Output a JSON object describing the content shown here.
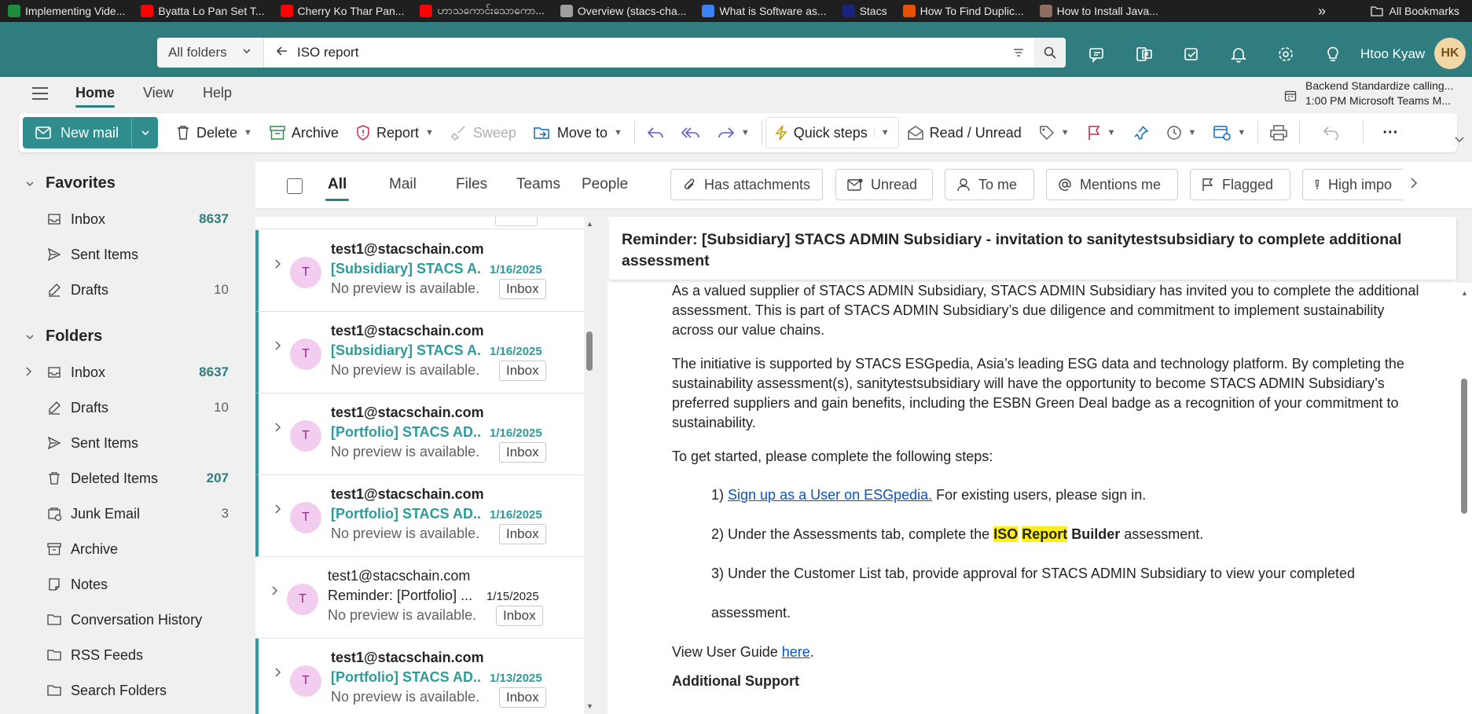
{
  "bookmarks": {
    "items": [
      {
        "label": "Implementing Vide...",
        "color": "#1e8e3e"
      },
      {
        "label": "Byatta Lo Pan Set T...",
        "color": "#ff0000"
      },
      {
        "label": "Cherry Ko Thar Pan...",
        "color": "#ff0000"
      },
      {
        "label": "ဟာသကောင်းသောကော...",
        "color": "#ff0000"
      },
      {
        "label": "Overview (stacs-cha...",
        "color": "#9e9e9e"
      },
      {
        "label": "What is Software as...",
        "color": "#3b82f6"
      },
      {
        "label": "Stacs",
        "color": "#1a237e"
      },
      {
        "label": "How To Find Duplic...",
        "color": "#e65100"
      },
      {
        "label": "How to Install Java...",
        "color": "#8d6e63"
      }
    ],
    "more": "»",
    "all_label": "All Bookmarks"
  },
  "header": {
    "folder_select": "All folders",
    "search_value": "ISO report",
    "user_name": "Htoo Kyaw",
    "user_initials": "HK",
    "accent": "#2f7d7e"
  },
  "ribbon_tabs": {
    "tabs": [
      "Home",
      "View",
      "Help"
    ],
    "reminder_title": "Backend Standardize calling...",
    "reminder_detail": "1:00 PM Microsoft Teams M..."
  },
  "ribbon": {
    "new_mail": "New mail",
    "delete": "Delete",
    "archive": "Archive",
    "report": "Report",
    "sweep": "Sweep",
    "move_to": "Move to",
    "quick_steps": "Quick steps",
    "read_unread": "Read / Unread",
    "more": "···"
  },
  "nav": {
    "favorites_label": "Favorites",
    "favorites": [
      {
        "label": "Inbox",
        "count": "8637",
        "unread": true,
        "icon": "inbox-icon"
      },
      {
        "label": "Sent Items",
        "count": "",
        "unread": false,
        "icon": "sent-icon"
      },
      {
        "label": "Drafts",
        "count": "10",
        "unread": false,
        "icon": "drafts-icon"
      }
    ],
    "folders_label": "Folders",
    "folders": [
      {
        "label": "Inbox",
        "count": "8637",
        "unread": true,
        "icon": "inbox-icon"
      },
      {
        "label": "Drafts",
        "count": "10",
        "unread": false,
        "icon": "drafts-icon"
      },
      {
        "label": "Sent Items",
        "count": "",
        "unread": false,
        "icon": "sent-icon"
      },
      {
        "label": "Deleted Items",
        "count": "207",
        "unread": true,
        "icon": "trash-icon"
      },
      {
        "label": "Junk Email",
        "count": "3",
        "unread": false,
        "icon": "junk-icon"
      },
      {
        "label": "Archive",
        "count": "",
        "unread": false,
        "icon": "archive-icon"
      },
      {
        "label": "Notes",
        "count": "",
        "unread": false,
        "icon": "notes-icon"
      },
      {
        "label": "Conversation History",
        "count": "",
        "unread": false,
        "icon": "folder-icon"
      },
      {
        "label": "RSS Feeds",
        "count": "",
        "unread": false,
        "icon": "folder-icon"
      },
      {
        "label": "Search Folders",
        "count": "",
        "unread": false,
        "icon": "folder-icon"
      }
    ]
  },
  "filters": {
    "tabs": [
      "All",
      "Mail",
      "Files",
      "Teams",
      "People"
    ],
    "chips": [
      "Has attachments",
      "Unread",
      "To me",
      "Mentions me",
      "Flagged",
      "High impo"
    ]
  },
  "messages": [
    {
      "from": "test1@stacschain.com",
      "subject": "[Subsidiary] STACS A...",
      "date": "1/16/2025",
      "preview": "No preview is available.",
      "tag": "Inbox",
      "unread": true,
      "initial": "T"
    },
    {
      "from": "test1@stacschain.com",
      "subject": "[Subsidiary] STACS A...",
      "date": "1/16/2025",
      "preview": "No preview is available.",
      "tag": "Inbox",
      "unread": true,
      "initial": "T"
    },
    {
      "from": "test1@stacschain.com",
      "subject": "[Portfolio] STACS AD...",
      "date": "1/16/2025",
      "preview": "No preview is available.",
      "tag": "Inbox",
      "unread": true,
      "initial": "T"
    },
    {
      "from": "test1@stacschain.com",
      "subject": "[Portfolio] STACS AD...",
      "date": "1/16/2025",
      "preview": "No preview is available.",
      "tag": "Inbox",
      "unread": true,
      "initial": "T"
    },
    {
      "from": "test1@stacschain.com",
      "subject": "Reminder: [Portfolio] ...",
      "date": "1/15/2025",
      "preview": "No preview is available.",
      "tag": "Inbox",
      "unread": false,
      "initial": "T"
    },
    {
      "from": "test1@stacschain.com",
      "subject": "[Portfolio] STACS AD...",
      "date": "1/13/2025",
      "preview": "No preview is available.",
      "tag": "Inbox",
      "unread": true,
      "initial": "T"
    }
  ],
  "reading": {
    "subject": "Reminder: [Subsidiary] STACS ADMIN Subsidiary - invitation to sanitytestsubsidiary to complete additional assessment",
    "para1": "As a valued supplier of STACS ADMIN Subsidiary, STACS ADMIN Subsidiary has invited you to complete the additional assessment. This is part of STACS ADMIN Subsidiary’s due diligence and commitment to implement sustainability across our value chains.",
    "para2": "The initiative is supported by STACS ESGpedia, Asia’s leading ESG data and technology platform. By completing the sustainability assessment(s), sanitytestsubsidiary will have the opportunity to become STACS ADMIN Subsidiary’s preferred suppliers and gain benefits, including the ESBN Green Deal badge as a recognition of your commitment to sustainability.",
    "para3": "To get started, please complete the following steps:",
    "step1_prefix": "1) ",
    "step1_link": "Sign up as a User on ESGpedia.",
    "step1_suffix": " For existing users, please sign in.",
    "step2_prefix": "2) Under the Assessments tab, complete the ",
    "step2_hl1": "ISO",
    "step2_hl2": "Report",
    "step2_bold": "Builder",
    "step2_suffix": " assessment.",
    "step3": "3) Under the Customer List tab, provide approval for STACS ADMIN Subsidiary to view your completed",
    "step3_cont": "assessment.",
    "guide_prefix": "View User Guide ",
    "guide_link": "here",
    "guide_suffix": ".",
    "support_heading": "Additional Support"
  }
}
